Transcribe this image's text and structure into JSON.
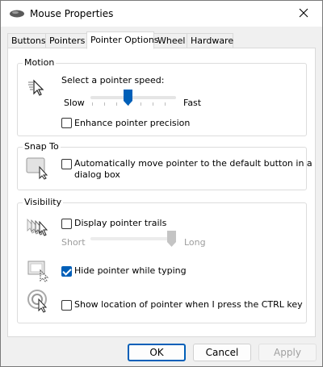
{
  "window": {
    "title": "Mouse Properties",
    "icon": "mouse-icon",
    "close_icon": "close-icon"
  },
  "tabs": [
    {
      "label": "Buttons",
      "active": false
    },
    {
      "label": "Pointers",
      "active": false
    },
    {
      "label": "Pointer Options",
      "active": true
    },
    {
      "label": "Wheel",
      "active": false
    },
    {
      "label": "Hardware",
      "active": false
    }
  ],
  "motion": {
    "legend": "Motion",
    "icon": "pointer-speed-icon",
    "speed_label": "Select a pointer speed:",
    "slow": "Slow",
    "fast": "Fast",
    "speed_value": 0.43,
    "enhance_label": "Enhance pointer precision",
    "enhance_checked": false
  },
  "snap_to": {
    "legend": "Snap To",
    "icon": "snap-to-default-button-icon",
    "label_line1": "Automatically move pointer to the default button in a",
    "label_line2": "dialog box",
    "checked": false
  },
  "visibility": {
    "legend": "Visibility",
    "trails_icon": "pointer-trails-icon",
    "trails_label": "Display pointer trails",
    "trails_checked": false,
    "short": "Short",
    "long": "Long",
    "trails_value": 1.0,
    "hide_icon": "hide-pointer-typing-icon",
    "hide_label": "Hide pointer while typing",
    "hide_checked": true,
    "ctrl_icon": "show-pointer-location-icon",
    "ctrl_label": "Show location of pointer when I press the CTRL key",
    "ctrl_checked": false
  },
  "buttons": {
    "ok": "OK",
    "cancel": "Cancel",
    "apply": "Apply"
  },
  "colors": {
    "accent": "#005fb8"
  }
}
